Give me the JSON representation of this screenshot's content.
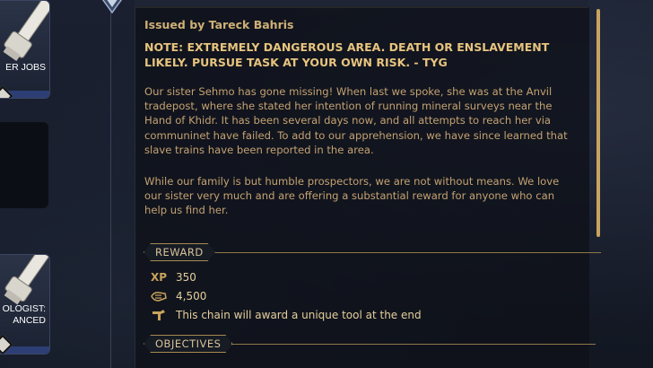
{
  "sidebar": {
    "cards": [
      {
        "label": "ER JOBS"
      },
      {
        "label": "OLOGIST:\nANCED"
      }
    ]
  },
  "mission": {
    "issued_by": "Issued by Tareck Bahris",
    "note": "NOTE: EXTREMELY DANGEROUS AREA. DEATH OR ENSLAVEMENT LIKELY. PURSUE TASK AT YOUR OWN RISK. - TYG",
    "paragraph1": "Our sister Sehmo has gone missing! When last we spoke, she was at the Anvil tradepost, where she stated her intention of running mineral surveys near the Hand of Khidr. It has been several days now, and all attempts to reach her via communinet have failed. To add to our apprehension, we have since learned that slave trains have been reported in the area.",
    "paragraph2": "While our family is but humble prospectors, we are not without means. We love our sister very much and are offering a substantial reward for anyone who can help us find her."
  },
  "reward": {
    "section_label": "REWARD",
    "xp_icon": "XP",
    "xp_value": "350",
    "credits_icon": "credits-icon",
    "credits_value": "4,500",
    "tool_icon": "tool-icon",
    "tool_text": "This chain will award a unique tool at the end"
  },
  "objectives": {
    "section_label": "OBJECTIVES"
  },
  "colors": {
    "accent_gold": "#c9a45e",
    "text_gold": "#c4a272",
    "panel_bg": "#0e1118"
  }
}
